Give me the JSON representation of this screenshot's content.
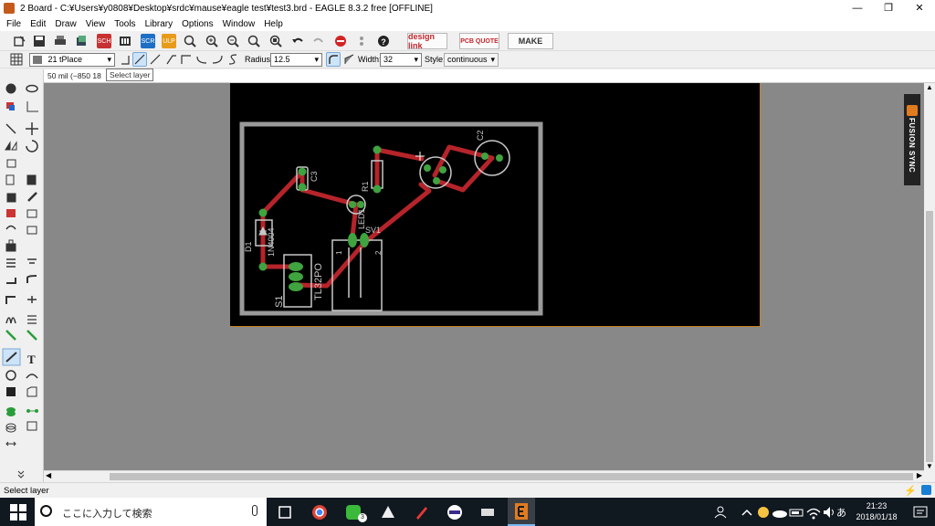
{
  "window": {
    "title": "2 Board - C:¥Users¥y0808¥Desktop¥srdc¥mause¥eagle test¥test3.brd - EAGLE 8.3.2 free [OFFLINE]",
    "minimize": "—",
    "maximize": "❐",
    "close": "✕"
  },
  "menu": [
    "File",
    "Edit",
    "Draw",
    "View",
    "Tools",
    "Library",
    "Options",
    "Window",
    "Help"
  ],
  "toolbar": {
    "design_link": "design link",
    "pcb_quote": "PCB QUOTE",
    "make": "MAKE"
  },
  "props": {
    "layer": "21 tPlace",
    "radius_label": "Radius:",
    "radius_value": "12.5",
    "width_label": "Width:",
    "width_value": "32",
    "style_label": "Style:",
    "style_value": "continuous"
  },
  "command": {
    "coords": "50 mil (−850 18",
    "tooltip": "Select layer"
  },
  "pcb": {
    "labels": {
      "c2": "C2",
      "c3": "C3",
      "r1": "R1",
      "led1": "LED1",
      "sv1": "SV1",
      "d1": "D1",
      "d1_part": "1N4004",
      "s1": "S1",
      "switch_part": "TL32PO",
      "pin1": "1",
      "pin2": "2"
    }
  },
  "fusion_sync": "FUSION SYNC",
  "status": "Select layer",
  "taskbar": {
    "search_placeholder": "ここに入力して検索",
    "line_badge": "3",
    "time": "21:23",
    "date": "2018/01/18",
    "ime": "あ"
  },
  "colors": {
    "board_bg": "#000000",
    "trace": "#b5242a",
    "pad": "#3fa33f",
    "silk": "#c8c8c8",
    "outline": "#9a9a9a",
    "canvas": "#888888",
    "eagle_orange": "#e07b20"
  }
}
